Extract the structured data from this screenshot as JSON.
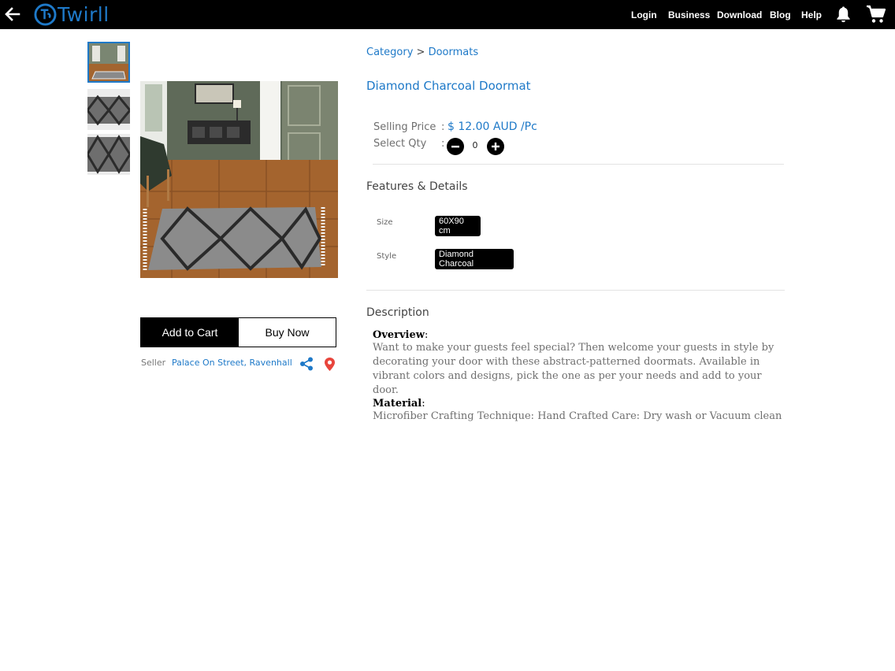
{
  "topbar": {
    "logo_text": "Twirll",
    "nav": [
      "Login",
      "Business",
      "Download",
      "Blog",
      "Help"
    ]
  },
  "colors": {
    "accent": "#1e79c8",
    "topbar": "#000000",
    "pin": "#e8453c"
  },
  "breadcrumb": {
    "category": "Category",
    "separator": ">",
    "current": "Doormats"
  },
  "product": {
    "title": "Diamond Charcoal Doormat",
    "selling_price_label": "Selling Price",
    "price": "$ 12.00 AUD /Pc",
    "qty_label": "Select Qty",
    "qty_value": "0"
  },
  "features": {
    "title": "Features & Details",
    "size_label": "Size",
    "size_value": "60X90 cm",
    "style_label": "Style",
    "style_value": "Diamond Charcoal"
  },
  "description": {
    "title": "Description",
    "overview_label": "Overview",
    "overview_text": "Want to make your guests feel special? Then welcome your guests in style by decorating your door with these abstract-patterned doormats. Available in vibrant colors and designs, pick the one as per your needs and add to your door.",
    "material_label": "Material",
    "material_text": "Microfiber Crafting Technique: Hand Crafted Care: Dry wash or Vacuum clean"
  },
  "actions": {
    "add_to_cart": "Add to Cart",
    "buy_now": "Buy Now"
  },
  "seller": {
    "label": "Seller",
    "name": "Palace On Street, Ravenhall"
  },
  "icons": [
    "back-arrow-icon",
    "logo-icon",
    "bell-icon",
    "cart-icon",
    "share-icon",
    "location-pin-icon",
    "minus-icon",
    "plus-icon"
  ]
}
